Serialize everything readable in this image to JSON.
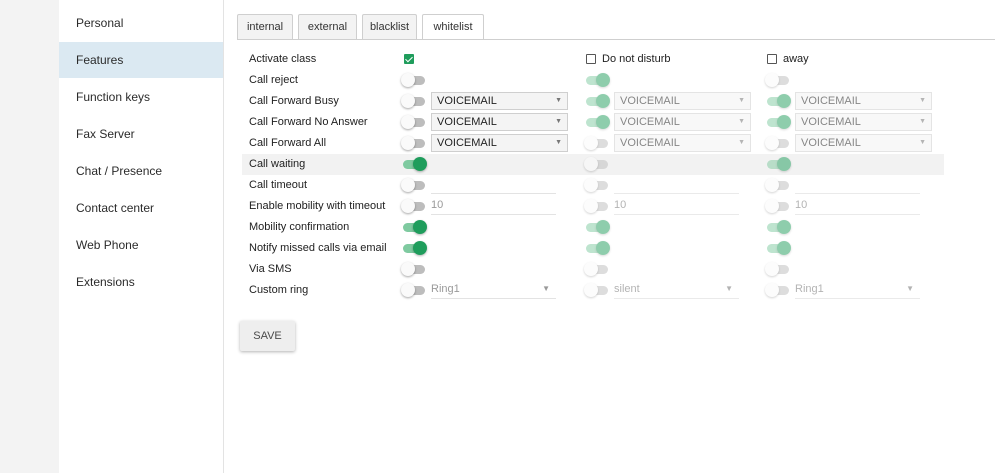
{
  "sidebar": {
    "items": [
      {
        "label": "Personal",
        "active": false
      },
      {
        "label": "Features",
        "active": true
      },
      {
        "label": "Function keys",
        "active": false
      },
      {
        "label": "Fax Server",
        "active": false
      },
      {
        "label": "Chat / Presence",
        "active": false
      },
      {
        "label": "Contact center",
        "active": false
      },
      {
        "label": "Web Phone",
        "active": false
      },
      {
        "label": "Extensions",
        "active": false
      }
    ]
  },
  "tabs": [
    {
      "label": "internal",
      "active": false
    },
    {
      "label": "external",
      "active": false
    },
    {
      "label": "blacklist",
      "active": false
    },
    {
      "label": "whitelist",
      "active": true
    }
  ],
  "columns": [
    {
      "key": "activate_class",
      "checkbox_checked": true,
      "label": ""
    },
    {
      "key": "do_not_disturb",
      "checkbox_checked": false,
      "label": "Do not disturb"
    },
    {
      "key": "away",
      "checkbox_checked": false,
      "label": "away"
    }
  ],
  "activate_class_label": "Activate class",
  "rows": [
    {
      "label": "Call reject",
      "cells": [
        {
          "toggle": false
        },
        {
          "toggle": true
        },
        {
          "toggle": false
        }
      ]
    },
    {
      "label": "Call Forward Busy",
      "cells": [
        {
          "toggle": false,
          "select": "VOICEMAIL"
        },
        {
          "toggle": true,
          "select": "VOICEMAIL"
        },
        {
          "toggle": true,
          "select": "VOICEMAIL"
        }
      ]
    },
    {
      "label": "Call Forward No Answer",
      "cells": [
        {
          "toggle": false,
          "select": "VOICEMAIL"
        },
        {
          "toggle": true,
          "select": "VOICEMAIL"
        },
        {
          "toggle": true,
          "select": "VOICEMAIL"
        }
      ]
    },
    {
      "label": "Call Forward All",
      "cells": [
        {
          "toggle": false,
          "select": "VOICEMAIL"
        },
        {
          "toggle": false,
          "select": "VOICEMAIL"
        },
        {
          "toggle": false,
          "select": "VOICEMAIL"
        }
      ]
    },
    {
      "label": "Call waiting",
      "highlight": true,
      "cells": [
        {
          "toggle": true
        },
        {
          "toggle": false
        },
        {
          "toggle": true
        }
      ]
    },
    {
      "label": "Call timeout",
      "cells": [
        {
          "toggle": false,
          "field": ""
        },
        {
          "toggle": false,
          "field": ""
        },
        {
          "toggle": false,
          "field": ""
        }
      ]
    },
    {
      "label": "Enable mobility with timeout",
      "cells": [
        {
          "toggle": false,
          "field": "10"
        },
        {
          "toggle": false,
          "field": "10"
        },
        {
          "toggle": false,
          "field": "10"
        }
      ]
    },
    {
      "label": "Mobility confirmation",
      "cells": [
        {
          "toggle": true
        },
        {
          "toggle": true
        },
        {
          "toggle": true
        }
      ]
    },
    {
      "label": "Notify missed calls via email",
      "cells": [
        {
          "toggle": true
        },
        {
          "toggle": true
        },
        {
          "toggle": true
        }
      ]
    },
    {
      "label": "Via SMS",
      "cells": [
        {
          "toggle": false
        },
        {
          "toggle": false
        },
        {
          "toggle": false
        }
      ]
    },
    {
      "label": "Custom ring",
      "cells": [
        {
          "toggle": false,
          "dropdown": "Ring1"
        },
        {
          "toggle": false,
          "dropdown": "silent"
        },
        {
          "toggle": false,
          "dropdown": "Ring1"
        }
      ]
    }
  ],
  "save_label": "SAVE",
  "colors": {
    "accent": "#1f9d5c",
    "accent_light": "#7fcaa0",
    "active_sidebar": "#dbe9f2",
    "highlight_row": "#f2f2f2"
  }
}
